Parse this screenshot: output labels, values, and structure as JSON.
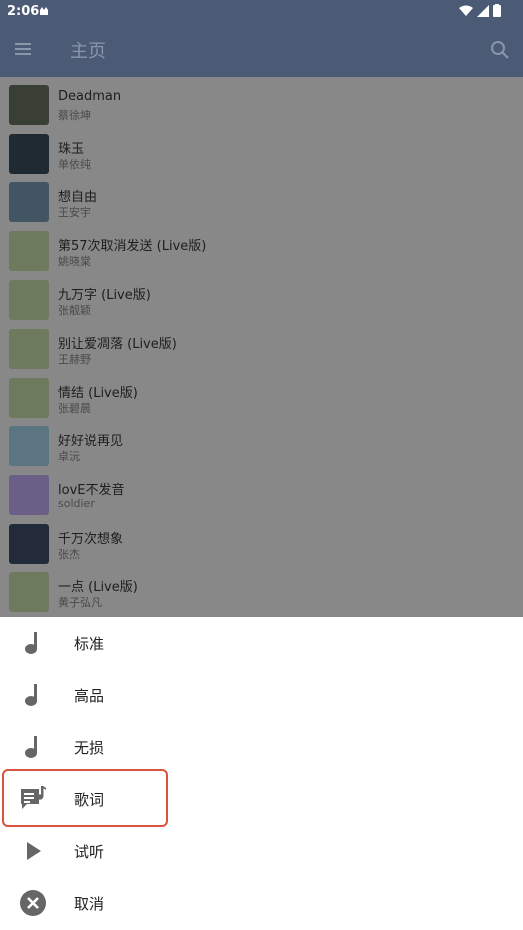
{
  "status_bar": {
    "time": "2:06"
  },
  "appbar": {
    "title": "主页"
  },
  "songs": [
    {
      "title": "Deadman",
      "artist": "蔡徐坤"
    },
    {
      "title": "珠玉",
      "artist": "单依纯"
    },
    {
      "title": "想自由",
      "artist": "王安宇"
    },
    {
      "title": "第57次取消发送 (Live版)",
      "artist": "姚晓棠"
    },
    {
      "title": "九万字 (Live版)",
      "artist": "张靓颖"
    },
    {
      "title": "别让爱凋落 (Live版)",
      "artist": "王赫野"
    },
    {
      "title": "情结 (Live版)",
      "artist": "张碧晨"
    },
    {
      "title": "好好说再见",
      "artist": "卓沅"
    },
    {
      "title": "lovE不发音",
      "artist": "soldier"
    },
    {
      "title": "千万次想象",
      "artist": "张杰"
    },
    {
      "title": "一点 (Live版)",
      "artist": "黄子弘凡"
    }
  ],
  "sheet": {
    "options": [
      {
        "label": "标准",
        "icon": "music-note-icon"
      },
      {
        "label": "高品",
        "icon": "music-note-icon"
      },
      {
        "label": "无损",
        "icon": "music-note-icon"
      },
      {
        "label": "歌词",
        "icon": "lyrics-icon"
      },
      {
        "label": "试听",
        "icon": "play-icon"
      },
      {
        "label": "取消",
        "icon": "cancel-icon"
      }
    ]
  },
  "colors": {
    "appbar": "#4b5a75",
    "highlight": "#d9523f"
  }
}
